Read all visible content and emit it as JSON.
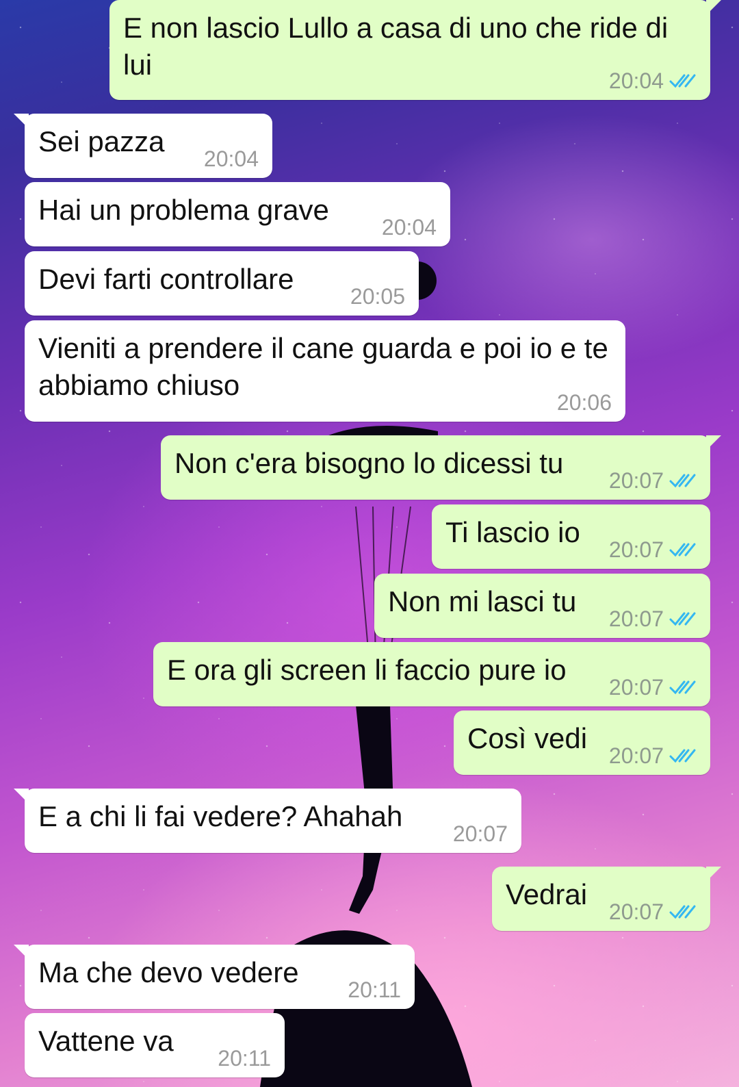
{
  "messages": [
    {
      "direction": "out",
      "text": "E non lascio Lullo a casa di uno che ride di lui",
      "time": "20:04",
      "status_icon": "double-check-icon"
    },
    {
      "direction": "in",
      "text": "Sei pazza",
      "time": "20:04"
    },
    {
      "direction": "in",
      "text": "Hai un problema grave",
      "time": "20:04"
    },
    {
      "direction": "in",
      "text": "Devi farti controllare",
      "time": "20:05"
    },
    {
      "direction": "in",
      "text": "Vieniti a prendere il cane guarda e poi io e te abbiamo chiuso",
      "time": "20:06"
    },
    {
      "direction": "out",
      "text": "Non c'era bisogno lo dicessi tu",
      "time": "20:07",
      "status_icon": "double-check-icon"
    },
    {
      "direction": "out",
      "text": "Ti lascio io",
      "time": "20:07",
      "status_icon": "double-check-icon"
    },
    {
      "direction": "out",
      "text": "Non mi lasci tu",
      "time": "20:07",
      "status_icon": "double-check-icon"
    },
    {
      "direction": "out",
      "text": "E ora gli screen li faccio pure io",
      "time": "20:07",
      "status_icon": "double-check-icon"
    },
    {
      "direction": "out",
      "text": "Così vedi",
      "time": "20:07",
      "status_icon": "double-check-icon"
    },
    {
      "direction": "in",
      "text": "E a chi li fai vedere? Ahahah",
      "time": "20:07"
    },
    {
      "direction": "out",
      "text": "Vedrai",
      "time": "20:07",
      "status_icon": "double-check-icon"
    },
    {
      "direction": "in",
      "text": "Ma che devo vedere",
      "time": "20:11"
    },
    {
      "direction": "in",
      "text": "Vattene va",
      "time": "20:11"
    }
  ],
  "colors": {
    "outgoing_bubble": "#e1fec6",
    "incoming_bubble": "#ffffff",
    "read_tick": "#34b7f1"
  }
}
